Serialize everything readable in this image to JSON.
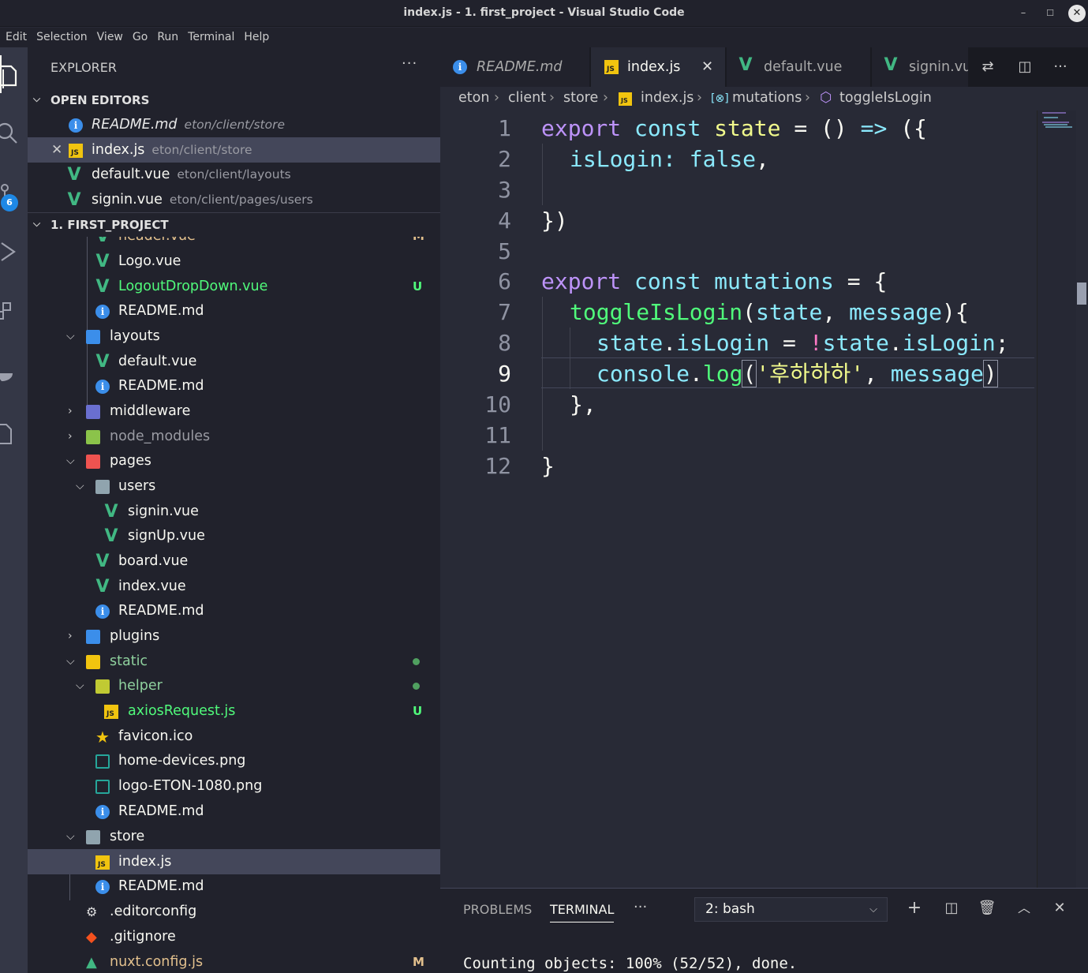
{
  "window": {
    "title": "index.js - 1. first_project - Visual Studio Code",
    "minimize": "–",
    "maximize": "☐",
    "close": "✕"
  },
  "menu": [
    "Edit",
    "Selection",
    "View",
    "Go",
    "Run",
    "Terminal",
    "Help"
  ],
  "activity": {
    "scm_badge": "6"
  },
  "explorer": {
    "title": "EXPLORER",
    "more": "···",
    "open_editors": {
      "title": "OPEN EDITORS",
      "items": [
        {
          "name": "README.md",
          "path": "eton/client/store",
          "icon": "info-icon"
        },
        {
          "name": "index.js",
          "path": "eton/client/store",
          "icon": "js-icon",
          "close": "✕"
        },
        {
          "name": "default.vue",
          "path": "eton/client/layouts",
          "icon": "vue-icon"
        },
        {
          "name": "signin.vue",
          "path": "eton/client/pages/users",
          "icon": "vue-icon"
        }
      ]
    },
    "project": {
      "title": "1. FIRST_PROJECT",
      "tree": [
        {
          "name": "header.vue",
          "status": "M"
        },
        {
          "name": "Logo.vue"
        },
        {
          "name": "LogoutDropDown.vue",
          "status": "U"
        },
        {
          "name": "README.md"
        },
        {
          "name": "layouts"
        },
        {
          "name": "default.vue"
        },
        {
          "name": "README.md"
        },
        {
          "name": "middleware"
        },
        {
          "name": "node_modules"
        },
        {
          "name": "pages"
        },
        {
          "name": "users"
        },
        {
          "name": "signin.vue"
        },
        {
          "name": "signUp.vue"
        },
        {
          "name": "board.vue"
        },
        {
          "name": "index.vue"
        },
        {
          "name": "README.md"
        },
        {
          "name": "plugins"
        },
        {
          "name": "static"
        },
        {
          "name": "helper"
        },
        {
          "name": "axiosRequest.js",
          "status": "U"
        },
        {
          "name": "favicon.ico"
        },
        {
          "name": "home-devices.png"
        },
        {
          "name": "logo-ETON-1080.png"
        },
        {
          "name": "README.md"
        },
        {
          "name": "store"
        },
        {
          "name": "index.js"
        },
        {
          "name": "README.md"
        },
        {
          "name": ".editorconfig"
        },
        {
          "name": ".gitignore"
        },
        {
          "name": "nuxt.config.js",
          "status": "M"
        }
      ]
    }
  },
  "tabs": [
    {
      "name": "README.md"
    },
    {
      "name": "index.js",
      "close": "✕"
    },
    {
      "name": "default.vue"
    },
    {
      "name": "signin.vu"
    }
  ],
  "tab_tools": {
    "more": "···"
  },
  "breadcrumb": {
    "parts": [
      "eton",
      "client",
      "store",
      "index.js",
      "mutations",
      "toggleIsLogin"
    ],
    "sep": "›"
  },
  "editor": {
    "line_numbers": [
      "1",
      "2",
      "3",
      "4",
      "5",
      "6",
      "7",
      "8",
      "9",
      "10",
      "11",
      "12"
    ],
    "current_line": 9,
    "lines": {
      "l1": {
        "a": "export",
        "b": "const",
        "c": "state",
        "d": "=",
        "e": "()",
        "f": "=>",
        "g": "({"
      },
      "l2": {
        "a": "isLogin",
        "b": ":",
        "c": "false",
        "d": ","
      },
      "l4": {
        "a": "})"
      },
      "l6": {
        "a": "export",
        "b": "const",
        "c": "mutations",
        "d": "=",
        "e": "{"
      },
      "l7": {
        "a": "toggleIsLogin",
        "b": "(",
        "c": "state",
        "d": ", ",
        "e": "message",
        "f": "){"
      },
      "l8": {
        "a": "state",
        "b": ".",
        "c": "isLogin",
        "d": " = ",
        "e": "!",
        "f": "state",
        "g": ".",
        "h": "isLogin",
        "i": ";"
      },
      "l9": {
        "a": "console",
        "b": ".",
        "c": "log",
        "d": "(",
        "e": "'후하하하'",
        "f": ", ",
        "g": "message",
        "h": ")"
      },
      "l10": {
        "a": "},"
      },
      "l12": {
        "a": "}"
      }
    }
  },
  "panel": {
    "tabs": [
      "PROBLEMS",
      "TERMINAL"
    ],
    "more": "···",
    "terminal_select": "2: bash",
    "terminal_output": "Counting objects: 100% (52/52), done."
  },
  "colors": {
    "background": "#282a36",
    "sidebar": "#21222c",
    "keyword": "#ff79c6",
    "function": "#50fa7b",
    "variable": "#8be9fd",
    "git_untracked": "#50fa7b",
    "git_modified": "#e2c08d"
  }
}
